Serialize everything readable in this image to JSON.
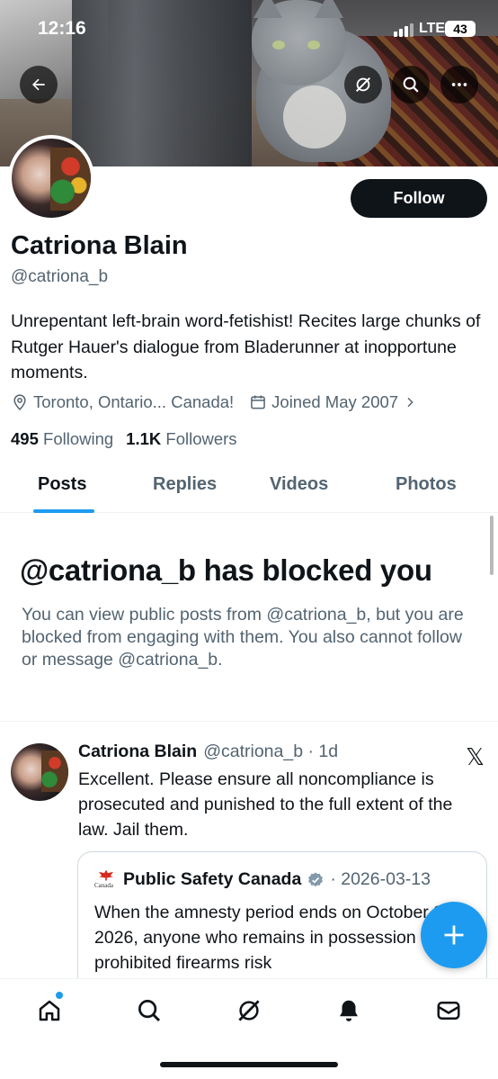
{
  "status_bar": {
    "time": "12:16",
    "network": "LTE",
    "battery": "43"
  },
  "header": {
    "back_icon": "arrow-left-icon",
    "grok_icon": "grok-icon",
    "search_icon": "search-icon",
    "more_icon": "more-icon"
  },
  "profile": {
    "name": "Catriona Blain",
    "handle": "@catriona_b",
    "follow_label": "Follow",
    "bio": "Unrepentant left-brain word-fetishist! Recites large chunks of Rutger Hauer's dialogue from Bladerunner at inopportune moments.",
    "location": "Toronto, Ontario... Canada!",
    "joined": "Joined May 2007",
    "following_count": "495",
    "following_label": "Following",
    "followers_count": "1.1K",
    "followers_label": "Followers"
  },
  "tabs": [
    {
      "label": "Posts",
      "active": true
    },
    {
      "label": "Replies"
    },
    {
      "label": "Videos"
    },
    {
      "label": "Photos"
    }
  ],
  "blocked": {
    "title": "@catriona_b has blocked you",
    "description": "You can view public posts from @catriona_b, but you are blocked from engaging with them. You also cannot follow or message @catriona_b."
  },
  "post": {
    "author_name": "Catriona Blain",
    "author_handle": "@catriona_b",
    "separator": "·",
    "age": "1d",
    "text": "Excellent. Please ensure all noncompliance is prosecuted and punished to the full extent of the law. Jail them.",
    "quote": {
      "flag_caption": "Canada",
      "author_name": "Public Safety Canada",
      "date": "· 2026-03-13",
      "text": "When the amnesty period ends on October 30, 2026, anyone who remains in possession of prohibited firearms risk"
    }
  },
  "x_logo": "𝕏",
  "colors": {
    "accent": "#1d9bf0",
    "text": "#0f1419",
    "muted": "#536471",
    "follow_bg": "#0f1419"
  },
  "bottom_nav": [
    "home-icon",
    "search-icon",
    "grok-icon",
    "bell-icon",
    "mail-icon"
  ]
}
